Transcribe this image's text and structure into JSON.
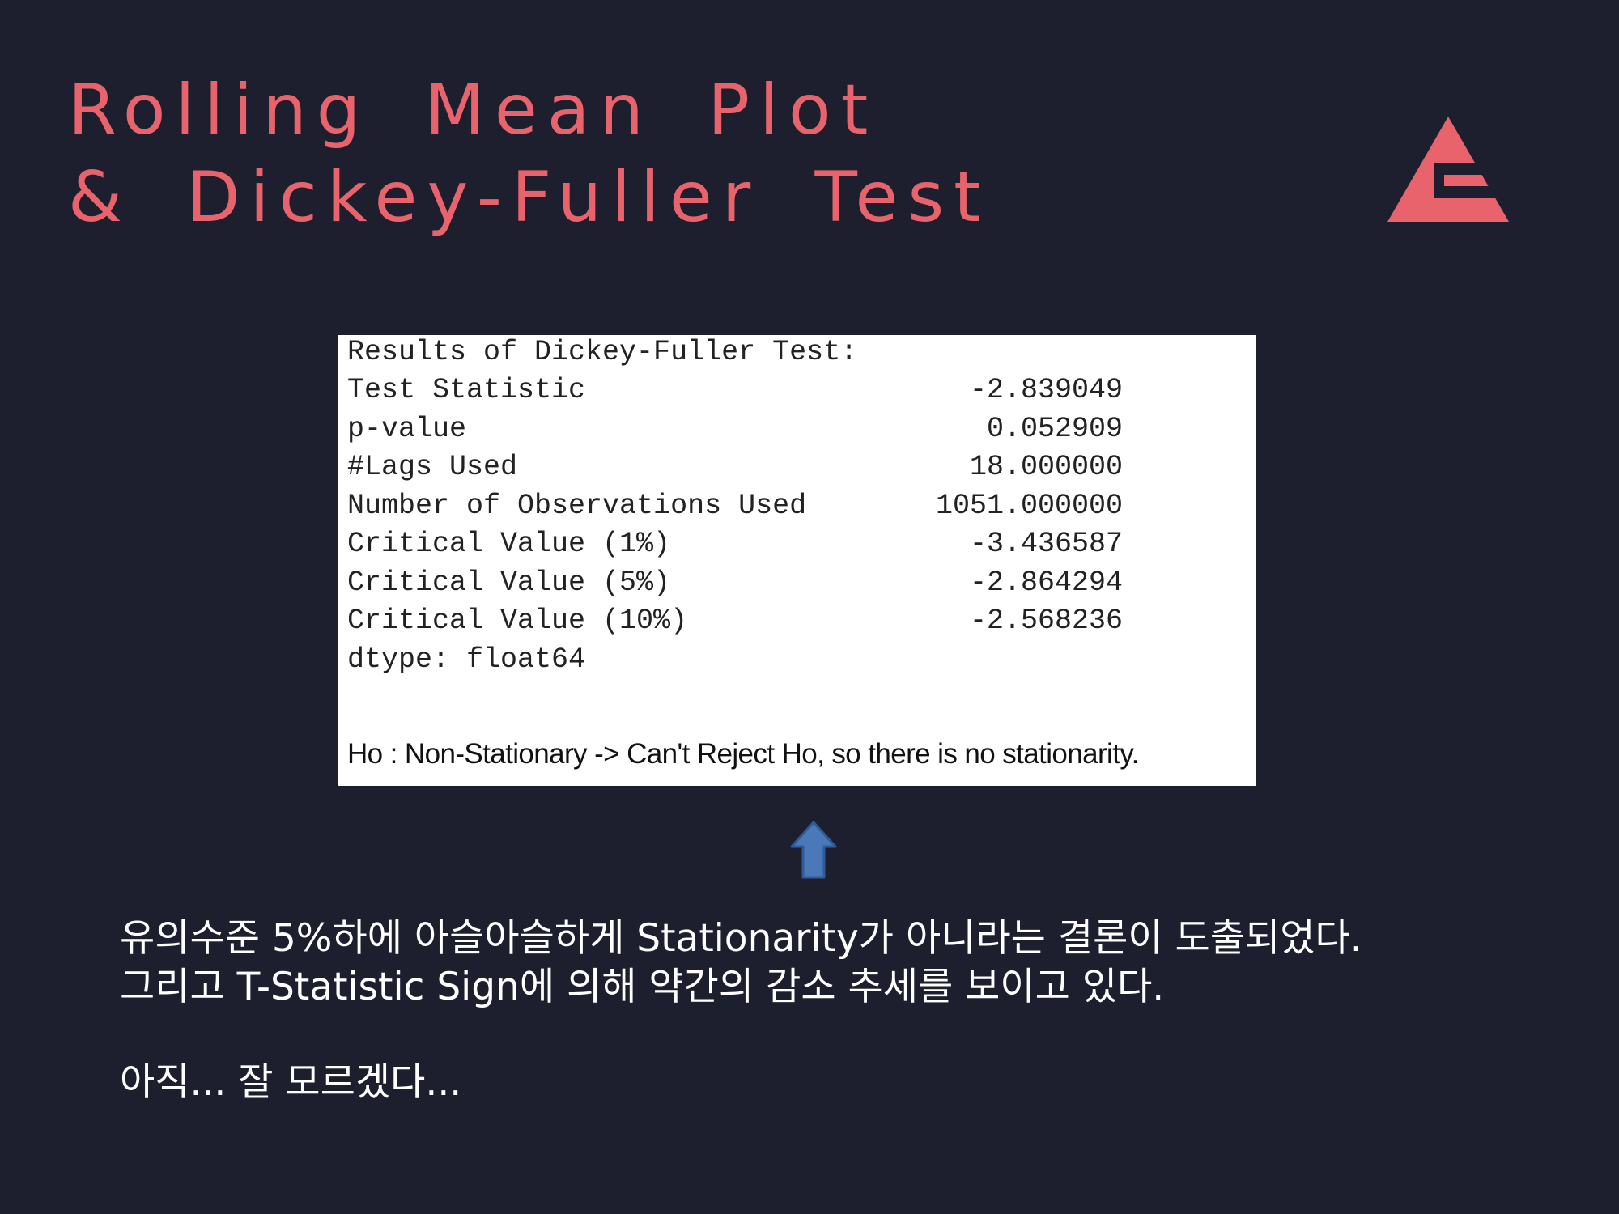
{
  "slide": {
    "title_line1": "Rolling Mean Plot",
    "title_line2": "& Dickey-Fuller Test",
    "accent_color": "#e8636b",
    "background_color": "#1d1f2e"
  },
  "logo": {
    "icon": "triangle-e-logo-icon"
  },
  "results": {
    "header": "Results of Dickey-Fuller Test:",
    "rows": [
      {
        "label": "Test Statistic",
        "value": "-2.839049"
      },
      {
        "label": "p-value",
        "value": "0.052909"
      },
      {
        "label": "#Lags Used",
        "value": "18.000000"
      },
      {
        "label": "Number of Observations Used",
        "value": "1051.000000"
      },
      {
        "label": "Critical Value (1%)",
        "value": "-3.436587"
      },
      {
        "label": "Critical Value (5%)",
        "value": "-2.864294"
      },
      {
        "label": "Critical Value (10%)",
        "value": "-2.568236"
      }
    ],
    "dtype": "dtype: float64",
    "note": "Ho : Non-Stationary -> Can't Reject Ho, so there is no stationarity."
  },
  "arrow": {
    "icon": "up-arrow-icon",
    "color": "#4a78b8"
  },
  "body": {
    "line1": "유의수준 5%하에 아슬아슬하게 Stationarity가 아니라는 결론이 도출되었다.",
    "line2": "그리고 T-Statistic Sign에 의해 약간의 감소 추세를 보이고 있다.",
    "line3": "아직... 잘 모르겠다..."
  }
}
